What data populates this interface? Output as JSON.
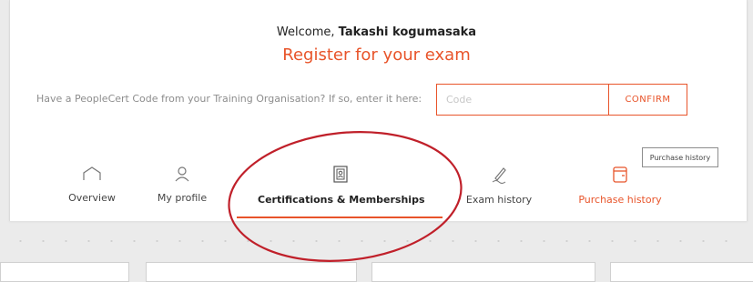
{
  "header": {
    "welcome_prefix": "Welcome,",
    "user_name": "Takashi kogumasaka",
    "title": "Register for your exam"
  },
  "code_section": {
    "prompt": "Have a PeopleCert Code from your Training Organisation? If so, enter it here:",
    "placeholder": "Code",
    "confirm_label": "CONFIRM"
  },
  "tooltip": "Purchase history",
  "tabs": [
    {
      "label": "Overview",
      "icon": "home-icon"
    },
    {
      "label": "My profile",
      "icon": "user-icon"
    },
    {
      "label": "Certifications & Memberships",
      "icon": "certificate-icon",
      "active": true
    },
    {
      "label": "Exam history",
      "icon": "pen-icon"
    },
    {
      "label": "Purchase history",
      "icon": "receipt-icon"
    }
  ],
  "colors": {
    "accent": "#e8542a",
    "annotation": "#c0202a"
  }
}
